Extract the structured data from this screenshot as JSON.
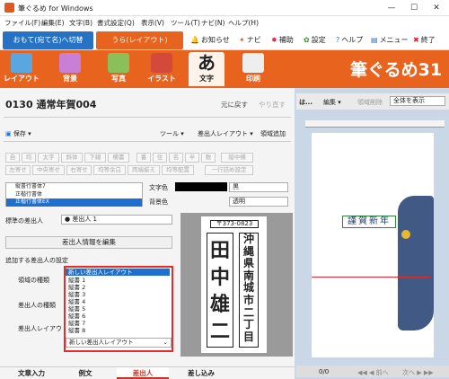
{
  "window": {
    "title": "筆ぐるめ for Windows",
    "min": "—",
    "max": "☐",
    "close": "✕"
  },
  "menu": [
    "ファイル(F)",
    "編集(E)",
    "文字(B)",
    "書式設定(Q)",
    "表示(V)",
    "ツール(T)",
    "ナビ(N)",
    "ヘルプ(H)"
  ],
  "toolbar": {
    "front_tab": "おもて(宛て名)へ切替",
    "back_tab": "うら(レイアウト)",
    "notice": "お知らせ",
    "navi": "ナビ",
    "assist": "補助",
    "settings": "設定",
    "help": "ヘルプ",
    "menu": "メニュー",
    "exit": "終了"
  },
  "ribbon": {
    "buttons": [
      "レイアウト",
      "背景",
      "写真",
      "イラスト",
      "文字",
      "印刷"
    ],
    "selected": "文字",
    "brand": "筆ぐるめ31",
    "brand_color": "#e8641e"
  },
  "doc": {
    "title": "0130 通常年賀004",
    "undo": "元に戻す",
    "redo": "やり直す"
  },
  "actions": {
    "save": "保存",
    "tools": "ツール",
    "sender_layout": "差出人レイアウト",
    "add_area": "領域追加"
  },
  "format_row1": [
    "自",
    "均",
    "太字",
    "斜体",
    "下線",
    "横書",
    "番",
    "住",
    "名",
    "半",
    "数",
    "縦中横"
  ],
  "format_row2": [
    "左寄せ",
    "中央寄せ",
    "右寄せ",
    "均等余白",
    "両端揃え",
    "均等配置",
    "一行詰め設定"
  ],
  "text_list": [
    "縦書行書体7",
    "正楷行書体",
    "正楷行書体EX"
  ],
  "text_color": {
    "label": "文字色",
    "value": "黒"
  },
  "bg_color": {
    "label": "背景色",
    "value": "透明"
  },
  "sender": {
    "label": "標準の差出人",
    "value": "● 差出人 1",
    "edit_button": "差出人情報を編集"
  },
  "settings": {
    "section": "追加する差出人の設定",
    "area_type": "領域の種類",
    "sender_type": "差出人の種類",
    "sender_layout": "差出人レイアウト",
    "options": [
      "新しい差出人レイアウト",
      "縦書 1",
      "縦書 2",
      "縦書 3",
      "縦書 4",
      "縦書 5",
      "縦書 6",
      "縦書 7",
      "縦書 8"
    ],
    "current": "新しい差出人レイアウト"
  },
  "preview": {
    "postal": "〒373-0823",
    "name_chars": [
      "田",
      "中",
      "雄",
      "二"
    ],
    "address_chars": [
      "沖",
      "縄",
      "県",
      "南",
      "城",
      "市",
      "二",
      "丁",
      "目"
    ]
  },
  "bottom_tabs": [
    "文章入力",
    "例文",
    "差出人",
    "差し込み"
  ],
  "active_tab": "差出人",
  "right": {
    "label": "は...",
    "edit": "編集",
    "delete": "領域削除",
    "zoom": "全体を表示",
    "greeting": "謹賀新年",
    "page": "0/0",
    "prev": "◀◀ ◀ 前へ",
    "next": "次へ ▶ ▶▶"
  }
}
